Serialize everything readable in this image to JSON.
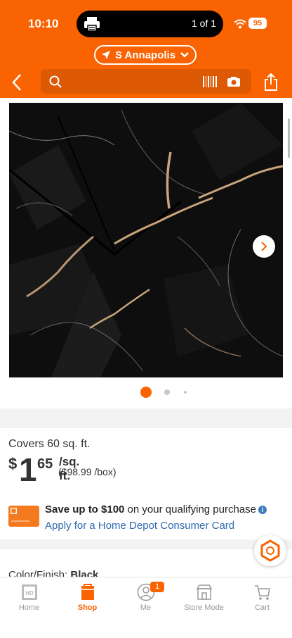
{
  "status": {
    "time": "10:10",
    "pill_text": "1 of 1",
    "battery": "95"
  },
  "location": {
    "label": "S Annapolis"
  },
  "search": {
    "placeholder": ""
  },
  "gallery": {
    "current_index": 1,
    "total_dots": 3
  },
  "product": {
    "coverage": "Covers 60 sq. ft.",
    "price_dollar": "$",
    "price_whole": "1",
    "price_cents": "65",
    "price_unit": "/sq. ft.",
    "price_box": "($98.99 /box)",
    "color_finish": "Color/Finish: Black"
  },
  "promo": {
    "bold": "Save up to $100",
    "rest": " on your qualifying purchase",
    "link": "Apply for a Home Depot Consumer Card"
  },
  "tabs": [
    {
      "label": "Home",
      "icon": "home-depot-logo-icon"
    },
    {
      "label": "Shop",
      "icon": "shop-bag-icon",
      "active": true
    },
    {
      "label": "Me",
      "icon": "person-icon",
      "badge": "1"
    },
    {
      "label": "Store Mode",
      "icon": "store-icon"
    },
    {
      "label": "Cart",
      "icon": "cart-icon"
    }
  ],
  "colors": {
    "brand": "#f96302",
    "link": "#2e6ab0"
  }
}
